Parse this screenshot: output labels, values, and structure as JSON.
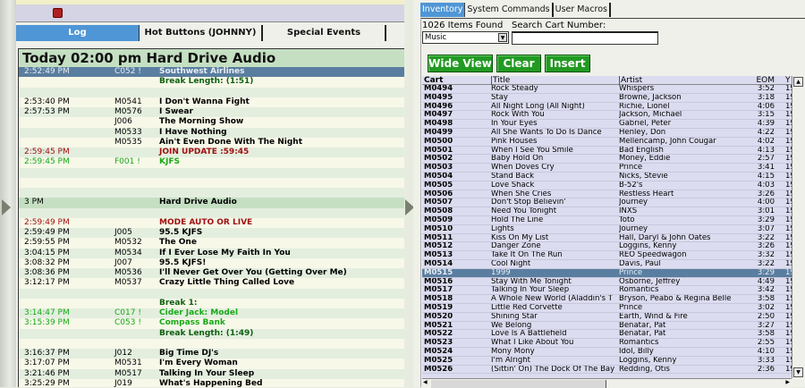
{
  "log": {
    "tabs": [
      "Log",
      "Hot Buttons (JOHNNY)",
      "Special Events"
    ],
    "header": "Today 02:00 pm Hard Drive Audio",
    "rows": [
      {
        "t": "2:52:49 PM",
        "c": "C052 !",
        "n": "Southwest Airlines",
        "k": "sel"
      },
      {
        "t": "",
        "c": "",
        "n": "Break Length: (1:51)",
        "k": "dgrn"
      },
      {
        "t": "",
        "c": "",
        "n": "",
        "k": ""
      },
      {
        "t": "2:53:40 PM",
        "c": "M0541",
        "n": "I Don't Wanna Fight",
        "k": ""
      },
      {
        "t": "2:57:53 PM",
        "c": "M0576",
        "n": "I Swear",
        "k": ""
      },
      {
        "t": "",
        "c": "J006",
        "n": "The Morning Show",
        "k": ""
      },
      {
        "t": "",
        "c": "M0533",
        "n": "I Have Nothing",
        "k": ""
      },
      {
        "t": "",
        "c": "M0535",
        "n": "Ain't Even Done With The Night",
        "k": ""
      },
      {
        "t": "2:59:45 PM",
        "c": "",
        "n": "JOIN UPDATE :59:45",
        "k": "red"
      },
      {
        "t": "2:59:45 PM",
        "c": "F001 !",
        "n": "KJFS",
        "k": "grn"
      },
      {
        "t": "",
        "c": "",
        "n": "",
        "k": ""
      },
      {
        "t": "",
        "c": "",
        "n": "",
        "k": ""
      },
      {
        "t": "",
        "c": "",
        "n": "",
        "k": ""
      },
      {
        "t": "3 PM",
        "c": "",
        "n": "Hard Drive Audio",
        "k": "hour"
      },
      {
        "t": "",
        "c": "",
        "n": "",
        "k": ""
      },
      {
        "t": "2:59:49 PM",
        "c": "",
        "n": "MODE AUTO OR LIVE",
        "k": "red"
      },
      {
        "t": "2:59:49 PM",
        "c": "J005",
        "n": "95.5 KJFS",
        "k": ""
      },
      {
        "t": "2:59:55 PM",
        "c": "M0532",
        "n": "The One",
        "k": ""
      },
      {
        "t": "3:04:15 PM",
        "c": "M0534",
        "n": "If I Ever Lose My Faith In You",
        "k": ""
      },
      {
        "t": "3:08:32 PM",
        "c": "J007",
        "n": "95.5 KJFS!",
        "k": ""
      },
      {
        "t": "3:08:36 PM",
        "c": "M0536",
        "n": "I'll Never Get Over You (Getting Over Me)",
        "k": ""
      },
      {
        "t": "3:12:17 PM",
        "c": "M0537",
        "n": "Crazy Little Thing Called Love",
        "k": ""
      },
      {
        "t": "",
        "c": "",
        "n": "",
        "k": ""
      },
      {
        "t": "",
        "c": "",
        "n": "Break 1:",
        "k": "dgrn"
      },
      {
        "t": "3:14:47 PM",
        "c": "C017 !",
        "n": "Cider Jack: Model",
        "k": "grn"
      },
      {
        "t": "3:15:39 PM",
        "c": "C053 !",
        "n": "Compass Bank",
        "k": "grn"
      },
      {
        "t": "",
        "c": "",
        "n": "Break Length: (1:49)",
        "k": "dgrn"
      },
      {
        "t": "",
        "c": "",
        "n": "",
        "k": ""
      },
      {
        "t": "3:16:37 PM",
        "c": "J012",
        "n": "Big Time DJ's",
        "k": ""
      },
      {
        "t": "3:17:07 PM",
        "c": "M0531",
        "n": "I'm Every Woman",
        "k": ""
      },
      {
        "t": "3:21:46 PM",
        "c": "M0517",
        "n": "Talking In Your Sleep",
        "k": ""
      },
      {
        "t": "3:25:29 PM",
        "c": "J019",
        "n": "What's Happening Bed",
        "k": ""
      }
    ]
  },
  "inv": {
    "tabs": [
      "Inventory",
      "System Commands",
      "User Macros"
    ],
    "found": "1026 Items Found",
    "search_label": "Search Cart Number:",
    "category": "Music",
    "search_value": "",
    "buttons": [
      "Wide View",
      "Clear",
      "Insert"
    ],
    "columns": [
      "Cart",
      "Title",
      "Artist",
      "EOM",
      "Y"
    ],
    "rows": [
      [
        "M0494",
        "Rock Steady",
        "Whispers",
        "3:52",
        "19"
      ],
      [
        "M0495",
        "Stay",
        "Browne, Jackson",
        "3:18",
        "19"
      ],
      [
        "M0496",
        "All Night Long (All Night)",
        "Richie, Lionel",
        "4:06",
        "19"
      ],
      [
        "M0497",
        "Rock With You",
        "Jackson, Michael",
        "3:15",
        "19"
      ],
      [
        "M0498",
        "In Your Eyes",
        "Gabriel, Peter",
        "4:39",
        "19"
      ],
      [
        "M0499",
        "All She Wants To Do Is Dance",
        "Henley, Don",
        "4:22",
        "19"
      ],
      [
        "M0500",
        "Pink Houses",
        "Mellencamp, John Cougar",
        "4:02",
        "19"
      ],
      [
        "M0501",
        "When I See You Smile",
        "Bad English",
        "4:13",
        "19"
      ],
      [
        "M0502",
        "Baby Hold On",
        "Money, Eddie",
        "2:57",
        "19"
      ],
      [
        "M0503",
        "When Doves Cry",
        "Prince",
        "3:41",
        "19"
      ],
      [
        "M0504",
        "Stand Back",
        "Nicks, Stevie",
        "4:15",
        "19"
      ],
      [
        "M0505",
        "Love Shack",
        "B-52's",
        "4:03",
        "19"
      ],
      [
        "M0506",
        "When She Cries",
        "Restless Heart",
        "3:26",
        "19"
      ],
      [
        "M0507",
        "Don't Stop Believin'",
        "Journey",
        "4:00",
        "19"
      ],
      [
        "M0508",
        "Need You Tonight",
        "INXS",
        "3:01",
        "19"
      ],
      [
        "M0509",
        "Hold The Line",
        "Toto",
        "3:29",
        "19"
      ],
      [
        "M0510",
        "Lights",
        "Journey",
        "3:07",
        "19"
      ],
      [
        "M0511",
        "Kiss On My List",
        "Hall, Daryl & John Oates",
        "3:22",
        "19"
      ],
      [
        "M0512",
        "Danger Zone",
        "Loggins, Kenny",
        "3:26",
        "19"
      ],
      [
        "M0513",
        "Take It On The Run",
        "REO Speedwagon",
        "3:32",
        "19"
      ],
      [
        "M0514",
        "Cool Night",
        "Davis, Paul",
        "3:22",
        "19"
      ],
      [
        "M0515",
        "1999",
        "Prince",
        "3:29",
        "19"
      ],
      [
        "M0516",
        "Stay With Me Tonight",
        "Osborne, Jeffrey",
        "4:49",
        "19"
      ],
      [
        "M0517",
        "Talking In Your Sleep",
        "Romantics",
        "3:42",
        "19"
      ],
      [
        "M0518",
        "A Whole New World (Aladdin's T",
        "Bryson, Peabo & Regina Belle",
        "3:58",
        "19"
      ],
      [
        "M0519",
        "Little Red Corvette",
        "Prince",
        "3:02",
        "19"
      ],
      [
        "M0520",
        "Shining Star",
        "Earth, Wind & Fire",
        "2:50",
        "19"
      ],
      [
        "M0521",
        "We Belong",
        "Benatar, Pat",
        "3:27",
        "19"
      ],
      [
        "M0522",
        "Love Is A Battlefield",
        "Benatar, Pat",
        "3:58",
        "19"
      ],
      [
        "M0523",
        "What I Like About You",
        "Romantics",
        "2:55",
        "19"
      ],
      [
        "M0524",
        "Mony Mony",
        "Idol, Billy",
        "4:10",
        "19"
      ],
      [
        "M0525",
        "I'm Alright",
        "Loggins, Kenny",
        "3:33",
        "19"
      ],
      [
        "M0526",
        "(Sittin' On) The Dock Of The Bay",
        "Redding, Otis",
        "2:36",
        "19"
      ]
    ],
    "selected_cart": "M0515"
  }
}
